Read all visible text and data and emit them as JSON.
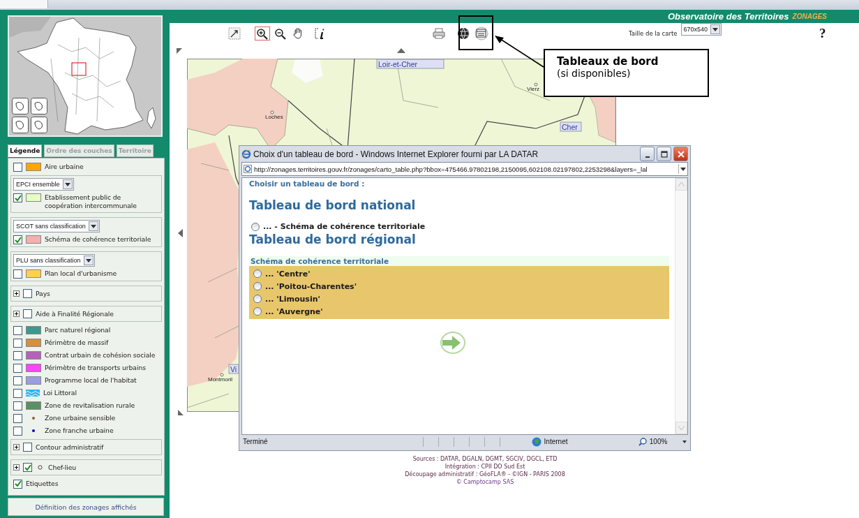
{
  "header": {
    "title": "Observatoire des Territoires",
    "brand": "ZONAGES"
  },
  "tabs": [
    {
      "label": "Légende",
      "selected": true
    },
    {
      "label": "Ordre des couches",
      "selected": false
    },
    {
      "label": "Territoire",
      "selected": false
    }
  ],
  "legend": [
    {
      "kind": "layer",
      "label": "Aire urbaine",
      "checked": false,
      "color": "#ffa500"
    },
    {
      "kind": "group",
      "select": "EPCI ensemble",
      "layer": {
        "label": "Etablissement public de coopération intercommunale",
        "checked": true,
        "color": "#e6ffc4"
      }
    },
    {
      "kind": "group",
      "select": "SCOT sans classification",
      "layer": {
        "label": "Schéma de cohérence territoriale",
        "checked": true,
        "color": "#f4b0b0"
      }
    },
    {
      "kind": "group",
      "select": "PLU sans classification",
      "layer": {
        "label": "Plan local d'urbanisme",
        "checked": false,
        "color": "#ffd050"
      }
    },
    {
      "kind": "expand",
      "label": "Pays",
      "checked": false
    },
    {
      "kind": "expand",
      "label": "Aide à Finalité Régionale",
      "checked": false
    },
    {
      "kind": "layer",
      "label": "Parc naturel régional",
      "checked": false,
      "color": "#3a9a8c"
    },
    {
      "kind": "layer",
      "label": "Périmètre de massif",
      "checked": false,
      "color": "#d4903c"
    },
    {
      "kind": "layer",
      "label": "Contrat urbain de cohésion sociale",
      "checked": false,
      "color": "#b462b8"
    },
    {
      "kind": "layer",
      "label": "Périmètre de transports urbains",
      "checked": false,
      "color": "#ff44ff"
    },
    {
      "kind": "layer",
      "label": "Programme local de l'habitat",
      "checked": false,
      "color": "#9c9ce4"
    },
    {
      "kind": "wave",
      "label": "Loi Littoral",
      "checked": false,
      "color": "#30b4f0"
    },
    {
      "kind": "layer",
      "label": "Zone de revitalisation rurale",
      "checked": false,
      "color": "#5c9064"
    },
    {
      "kind": "point",
      "label": "Zone urbaine sensible",
      "checked": false,
      "color": "#8a6040"
    },
    {
      "kind": "point",
      "label": "Zone franche urbaine",
      "checked": false,
      "color": "#0000c8"
    },
    {
      "kind": "expand",
      "label": "Contour administratif",
      "checked": false
    },
    {
      "kind": "expand-point",
      "label": "Chef-lieu",
      "checked": true
    },
    {
      "kind": "plain",
      "label": "Etiquettes",
      "checked": true
    }
  ],
  "definition_button": "Définition des zonages affichés",
  "tools": [
    {
      "kind": "full-extent",
      "selected": false
    },
    {
      "kind": "zoom-in",
      "selected": true
    },
    {
      "kind": "zoom-out",
      "selected": false
    },
    {
      "kind": "pan",
      "selected": false
    },
    {
      "kind": "info",
      "selected": false
    }
  ],
  "map_size": {
    "label": "Taille de la carte",
    "value": "670x540"
  },
  "help": "?",
  "map_labels": [
    {
      "kind": "area",
      "text": "Loir-et-Cher"
    },
    {
      "kind": "town",
      "text": "Loches"
    },
    {
      "kind": "town",
      "text": "Vierz"
    },
    {
      "kind": "area",
      "text": "Cher"
    },
    {
      "kind": "area",
      "text": "Vi"
    },
    {
      "kind": "town",
      "text": "Montmoril"
    }
  ],
  "callout": {
    "title": "Tableaux de bord",
    "note": "(si disponibles)"
  },
  "popup": {
    "title": "Choix d'un tableau de bord - Windows Internet Explorer fourni par LA DATAR",
    "url": "http://zonages.territoires.gouv.fr/zonages/carto_table.php?bbox=475466.97802198,2150095,602108.02197802,2253298&layers=_lal",
    "prompt": "Choisir un tableau de bord :",
    "national_heading": "Tableau de bord national",
    "national_options": [
      {
        "label": "... - Schéma de cohérence territoriale",
        "selected": false
      }
    ],
    "regional_heading": "Tableau de bord régional",
    "regional_section": "Schéma de cohérence territoriale",
    "regional_options": [
      {
        "label": "... 'Centre'",
        "selected": false
      },
      {
        "label": "... 'Poitou-Charentes'",
        "selected": false
      },
      {
        "label": "... 'Limousin'",
        "selected": false
      },
      {
        "label": "... 'Auvergne'",
        "selected": false
      }
    ],
    "status": "Terminé",
    "zone": "Internet",
    "zoom": "100%"
  },
  "footer": {
    "lines": [
      "Sources : DATAR, DGALN, DGMT, SGCIV, DGCL, ETD",
      "Intégration : CPII DO Sud Est",
      "Découpage administratif : GéoFLA® - ©IGN - PARIS 2008"
    ],
    "link": "© Camptocamp SAS"
  }
}
